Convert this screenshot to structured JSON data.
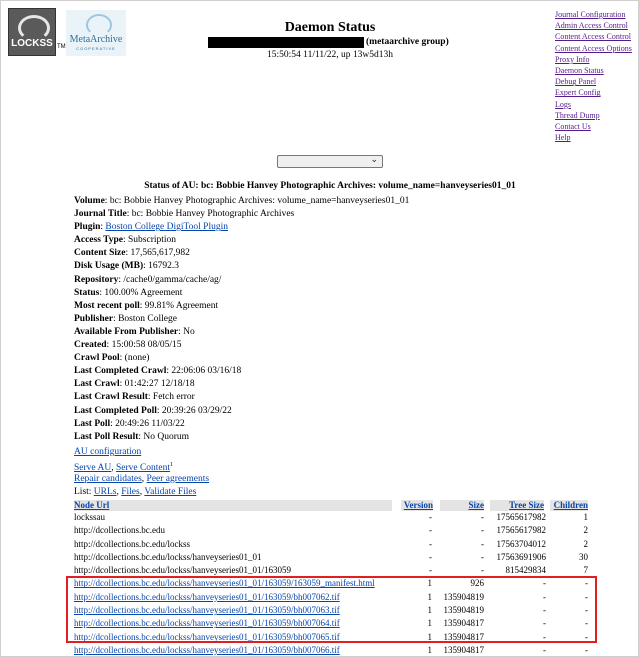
{
  "header": {
    "title": "Daemon Status",
    "group": "(metaarchive group)",
    "time_line": "15:50:54 11/11/22, up 13w5d13h",
    "logo_lockss_text": "LOCKSS",
    "logo_tm": "TM",
    "logo_meta_name": "MetaArchive",
    "logo_meta_sub": "COOPERATIVE"
  },
  "nav": [
    "Journal Configuration",
    "Admin Access Control",
    "Content Access Control",
    "Content Access Options",
    "Proxy Info",
    "Daemon Status",
    "Debug Panel",
    "Expert Config",
    "Logs",
    "Thread Dump",
    "Contact Us",
    "Help"
  ],
  "selector": {
    "selected": "",
    "icon": "chevron-down-icon"
  },
  "au": {
    "heading": "Status of AU: bc: Bobbie Hanvey Photographic Archives: volume_name=hanveyseries01_01",
    "volume_label": "Volume",
    "volume": "bc: Bobbie Hanvey Photographic Archives: volume_name=hanveyseries01_01",
    "journal_title_label": "Journal Title",
    "journal_title": "bc: Bobbie Hanvey Photographic Archives",
    "plugin_label": "Plugin",
    "plugin": "Boston College DigiTool Plugin",
    "access_type_label": "Access Type",
    "access_type": "Subscription",
    "content_size_label": "Content Size",
    "content_size": "17,565,617,982",
    "disk_usage_label": "Disk Usage (MB)",
    "disk_usage": "16792.3",
    "repository_label": "Repository",
    "repository": "/cache0/gamma/cache/ag/",
    "status_label": "Status",
    "status": "100.00% Agreement",
    "recent_poll_label": "Most recent poll",
    "recent_poll": "99.81% Agreement",
    "publisher_label": "Publisher",
    "publisher": "Boston College",
    "available_label": "Available From Publisher",
    "available": "No",
    "created_label": "Created",
    "created": "15:00:58 08/05/15",
    "crawl_pool_label": "Crawl Pool",
    "crawl_pool": "(none)",
    "last_completed_crawl_label": "Last Completed Crawl",
    "last_completed_crawl": "22:06:06 03/16/18",
    "last_crawl_label": "Last Crawl",
    "last_crawl": "01:42:27 12/18/18",
    "last_crawl_result_label": "Last Crawl Result",
    "last_crawl_result": "Fetch error",
    "last_completed_poll_label": "Last Completed Poll",
    "last_completed_poll": "20:39:26 03/29/22",
    "last_poll_label": "Last Poll",
    "last_poll": "20:49:26 11/03/22",
    "last_poll_result_label": "Last Poll Result",
    "last_poll_result": "No Quorum"
  },
  "actions": {
    "au_configuration": "AU configuration",
    "serve_au": "Serve AU",
    "serve_content": "Serve Content",
    "serve_content_sup": "1",
    "repair_candidates": "Repair candidates",
    "peer_agreements": "Peer agreements",
    "list_label": "List",
    "urls": "URLs",
    "files": "Files",
    "validate_files": "Validate Files"
  },
  "table": {
    "headers": {
      "node_url": "Node Url",
      "version": "Version",
      "size": "Size",
      "tree_size": "Tree Size",
      "children": "Children"
    },
    "rows": [
      {
        "url": "lockssau",
        "link": false,
        "version": "-",
        "size": "-",
        "tree_size": "17565617982",
        "children": "1"
      },
      {
        "url": "http://dcollections.bc.edu",
        "link": false,
        "version": "-",
        "size": "-",
        "tree_size": "17565617982",
        "children": "2"
      },
      {
        "url": "http://dcollections.bc.edu/lockss",
        "link": false,
        "version": "-",
        "size": "-",
        "tree_size": "17563704012",
        "children": "2"
      },
      {
        "url": "http://dcollections.bc.edu/lockss/hanveyseries01_01",
        "link": false,
        "version": "-",
        "size": "-",
        "tree_size": "17563691906",
        "children": "30"
      },
      {
        "url": "http://dcollections.bc.edu/lockss/hanveyseries01_01/163059",
        "link": false,
        "version": "-",
        "size": "-",
        "tree_size": "815429834",
        "children": "7"
      },
      {
        "url": "http://dcollections.bc.edu/lockss/hanveyseries01_01/163059/163059_manifest.html",
        "link": true,
        "version": "1",
        "size": "926",
        "tree_size": "-",
        "children": "-"
      },
      {
        "url": "http://dcollections.bc.edu/lockss/hanveyseries01_01/163059/bh007062.tif",
        "link": true,
        "version": "1",
        "size": "135904819",
        "tree_size": "-",
        "children": "-"
      },
      {
        "url": "http://dcollections.bc.edu/lockss/hanveyseries01_01/163059/bh007063.tif",
        "link": true,
        "version": "1",
        "size": "135904819",
        "tree_size": "-",
        "children": "-"
      },
      {
        "url": "http://dcollections.bc.edu/lockss/hanveyseries01_01/163059/bh007064.tif",
        "link": true,
        "version": "1",
        "size": "135904817",
        "tree_size": "-",
        "children": "-"
      },
      {
        "url": "http://dcollections.bc.edu/lockss/hanveyseries01_01/163059/bh007065.tif",
        "link": true,
        "version": "1",
        "size": "135904817",
        "tree_size": "-",
        "children": "-"
      },
      {
        "url": "http://dcollections.bc.edu/lockss/hanveyseries01_01/163059/bh007066.tif",
        "link": true,
        "version": "1",
        "size": "135904817",
        "tree_size": "-",
        "children": "-"
      }
    ]
  },
  "colors": {
    "link": "#0645ad",
    "visited": "#551a8b",
    "highlight_box": "#e02020",
    "header_bg": "#e4e4e4"
  }
}
